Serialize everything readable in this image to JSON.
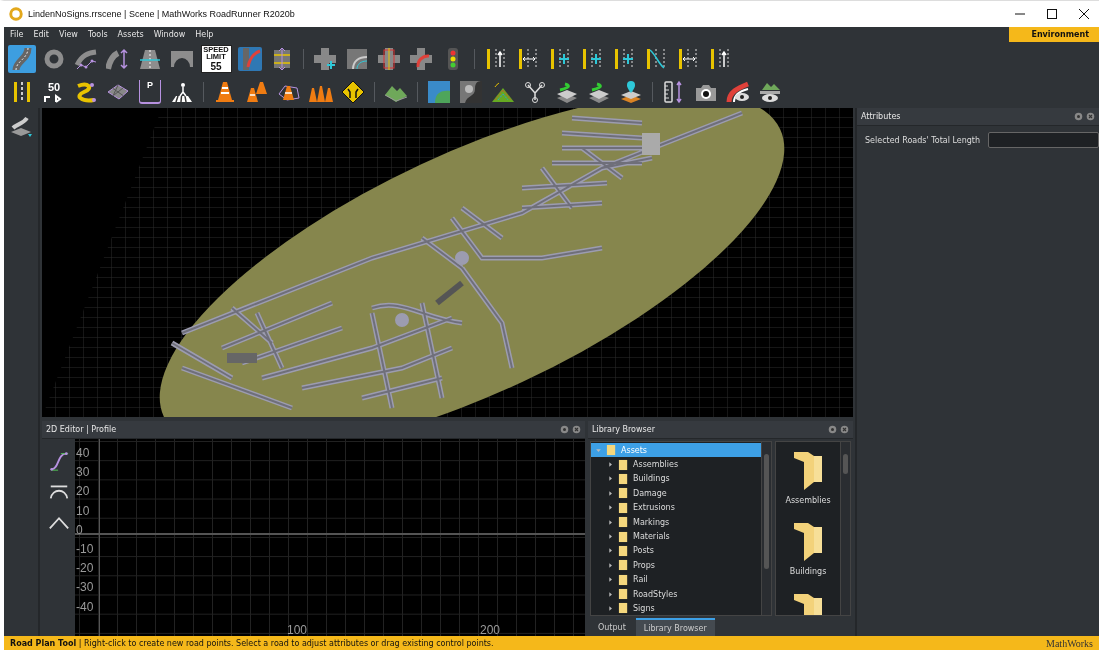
{
  "window": {
    "title": "LindenNoSigns.rrscene | Scene | MathWorks RoadRunner R2020b"
  },
  "menu": [
    "File",
    "Edit",
    "View",
    "Tools",
    "Assets",
    "Window",
    "Help"
  ],
  "mode_badge": "Environment",
  "toolbars": [
    [
      {
        "kind": "road",
        "selected": true
      },
      {
        "kind": "ring",
        "selected": false
      },
      {
        "kind": "spline-road",
        "selected": false
      },
      {
        "kind": "road-arrow",
        "selected": false
      },
      {
        "kind": "road-line",
        "selected": false
      },
      {
        "kind": "bridge",
        "selected": false
      },
      {
        "kind": "speed-sign",
        "selected": false,
        "caption": "SPEED LIMIT",
        "text": "55"
      },
      {
        "kind": "road-plan",
        "selected": false
      },
      {
        "kind": "cross-section",
        "selected": false
      },
      {
        "kind": "separator"
      },
      {
        "kind": "junction-add",
        "selected": false
      },
      {
        "kind": "junction-merge",
        "selected": false
      },
      {
        "kind": "junction-box",
        "selected": false
      },
      {
        "kind": "junction-corner",
        "selected": false
      },
      {
        "kind": "traffic-light",
        "selected": false
      },
      {
        "kind": "separator"
      },
      {
        "kind": "lane-arrows",
        "selected": false
      },
      {
        "kind": "lane-width",
        "selected": false
      },
      {
        "kind": "lane-plus",
        "selected": false
      },
      {
        "kind": "lane-plus",
        "selected": false
      },
      {
        "kind": "lane-plus",
        "selected": false
      },
      {
        "kind": "lane-cross",
        "selected": false
      },
      {
        "kind": "lane-width",
        "selected": false
      },
      {
        "kind": "lane-arrows",
        "selected": false
      }
    ],
    [
      {
        "kind": "marking",
        "selected": false
      },
      {
        "kind": "speed-text",
        "selected": false,
        "text": "50"
      },
      {
        "kind": "curve-points",
        "selected": false
      },
      {
        "kind": "surface",
        "selected": false
      },
      {
        "kind": "parking",
        "selected": false,
        "text": "P"
      },
      {
        "kind": "crosswalk",
        "selected": false
      },
      {
        "kind": "separator"
      },
      {
        "kind": "cone",
        "selected": false
      },
      {
        "kind": "cones",
        "selected": false
      },
      {
        "kind": "cone-area",
        "selected": false
      },
      {
        "kind": "cone-row",
        "selected": false
      },
      {
        "kind": "warning-sign",
        "selected": false
      },
      {
        "kind": "separator"
      },
      {
        "kind": "terrain",
        "selected": false
      },
      {
        "kind": "separator"
      },
      {
        "kind": "map",
        "selected": false
      },
      {
        "kind": "heightmap",
        "selected": false
      },
      {
        "kind": "point-cloud",
        "selected": false
      },
      {
        "kind": "branch",
        "selected": false
      },
      {
        "kind": "layers-green",
        "selected": false
      },
      {
        "kind": "layers-green",
        "selected": false
      },
      {
        "kind": "layers-pin",
        "selected": false
      },
      {
        "kind": "separator"
      },
      {
        "kind": "ruler",
        "selected": false
      },
      {
        "kind": "camera",
        "selected": false
      },
      {
        "kind": "view-road",
        "selected": false
      },
      {
        "kind": "view-terrain",
        "selected": false
      }
    ]
  ],
  "side_tools": [
    {
      "kind": "road-stack",
      "selected": false
    }
  ],
  "attributes": {
    "title": "Attributes",
    "fields": [
      {
        "label": "Selected Roads' Total Length"
      }
    ]
  },
  "profile_editor": {
    "title": "2D Editor | Profile",
    "tools": [
      {
        "kind": "profile-curve"
      },
      {
        "kind": "arch"
      },
      {
        "kind": "peak"
      }
    ],
    "y_labels": [
      "40",
      "30",
      "20",
      "10",
      "0",
      "-10",
      "-20",
      "-30",
      "-40"
    ],
    "x_labels": [
      "100",
      "200"
    ]
  },
  "library": {
    "title": "Library Browser",
    "tree": [
      {
        "label": "Assets",
        "expanded": true,
        "selected": true,
        "children": [
          {
            "label": "Assemblies",
            "expanded": false,
            "selected": false
          },
          {
            "label": "Buildings",
            "expanded": false,
            "selected": false
          },
          {
            "label": "Damage",
            "expanded": false,
            "selected": false
          },
          {
            "label": "Extrusions",
            "expanded": false,
            "selected": false
          },
          {
            "label": "Markings",
            "expanded": false,
            "selected": false
          },
          {
            "label": "Materials",
            "expanded": false,
            "selected": false
          },
          {
            "label": "Posts",
            "expanded": false,
            "selected": false
          },
          {
            "label": "Props",
            "expanded": false,
            "selected": false
          },
          {
            "label": "Rail",
            "expanded": false,
            "selected": false
          },
          {
            "label": "RoadStyles",
            "expanded": false,
            "selected": false
          },
          {
            "label": "Signs",
            "expanded": false,
            "selected": false
          }
        ]
      }
    ],
    "tiles": [
      {
        "kind": "folder",
        "label": "Assemblies"
      },
      {
        "kind": "folder",
        "label": "Buildings"
      },
      {
        "kind": "folder"
      }
    ]
  },
  "bottom_tabs": [
    {
      "label": "Output",
      "selected": false
    },
    {
      "label": "Library Browser",
      "selected": true
    }
  ],
  "status_bar": {
    "message": "**Road Plan Tool** | Right-click to create new road points. Select a road to adjust attributes or drag existing control points.",
    "brand": "MathWorks"
  }
}
